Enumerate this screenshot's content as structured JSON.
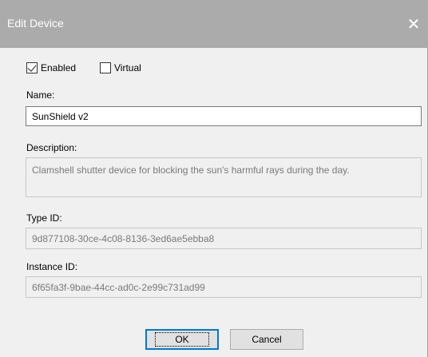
{
  "window": {
    "title": "Edit Device",
    "close_glyph": "✕"
  },
  "options": {
    "enabled_label": "Enabled",
    "enabled_checked": true,
    "virtual_label": "Virtual",
    "virtual_checked": false
  },
  "fields": {
    "name_label": "Name:",
    "name_value": "SunShield v2",
    "description_label": "Description:",
    "description_value": "Clamshell shutter device for blocking the sun's harmful rays during the day.",
    "type_id_label": "Type ID:",
    "type_id_value": "9d877108-30ce-4c08-8136-3ed6ae5ebba8",
    "instance_id_label": "Instance ID:",
    "instance_id_value": "6f65fa3f-9bae-44cc-ad0c-2e99c731ad99"
  },
  "buttons": {
    "ok_label": "OK",
    "cancel_label": "Cancel"
  }
}
